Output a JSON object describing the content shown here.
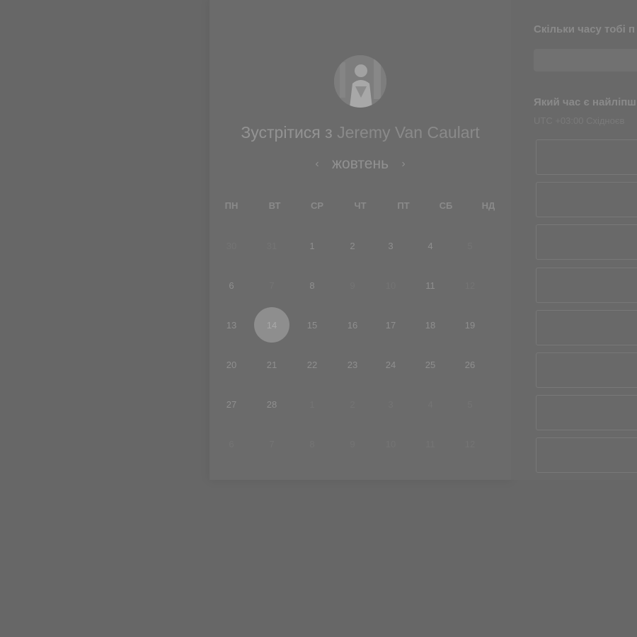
{
  "calendar": {
    "title_prefix": "Зустрітися з",
    "person_name": "Jeremy Van Caulart",
    "month": "жовтень",
    "prev_arrow": "‹",
    "next_arrow": "›",
    "weekdays": [
      "ПН",
      "ВТ",
      "СР",
      "ЧТ",
      "ПТ",
      "СБ",
      "НД"
    ],
    "weeks": [
      [
        {
          "d": "30",
          "m": true
        },
        {
          "d": "31",
          "m": true
        },
        {
          "d": "1",
          "m": false
        },
        {
          "d": "2",
          "m": false
        },
        {
          "d": "3",
          "m": false
        },
        {
          "d": "4",
          "m": false
        },
        {
          "d": "5",
          "m": true
        }
      ],
      [
        {
          "d": "6",
          "m": false
        },
        {
          "d": "7",
          "m": true
        },
        {
          "d": "8",
          "m": false
        },
        {
          "d": "9",
          "m": true
        },
        {
          "d": "10",
          "m": true
        },
        {
          "d": "11",
          "m": false
        },
        {
          "d": "12",
          "m": true
        }
      ],
      [
        {
          "d": "13",
          "m": false
        },
        {
          "d": "14",
          "m": false,
          "selected": true
        },
        {
          "d": "15",
          "m": false
        },
        {
          "d": "16",
          "m": false
        },
        {
          "d": "17",
          "m": false
        },
        {
          "d": "18",
          "m": false
        },
        {
          "d": "19",
          "m": false
        }
      ],
      [
        {
          "d": "20",
          "m": false
        },
        {
          "d": "21",
          "m": false
        },
        {
          "d": "22",
          "m": false
        },
        {
          "d": "23",
          "m": false
        },
        {
          "d": "24",
          "m": false
        },
        {
          "d": "25",
          "m": false
        },
        {
          "d": "26",
          "m": false
        }
      ],
      [
        {
          "d": "27",
          "m": false
        },
        {
          "d": "28",
          "m": false
        },
        {
          "d": "1",
          "m": true
        },
        {
          "d": "2",
          "m": true
        },
        {
          "d": "3",
          "m": true
        },
        {
          "d": "4",
          "m": true
        },
        {
          "d": "5",
          "m": true
        }
      ],
      [
        {
          "d": "6",
          "m": true
        },
        {
          "d": "7",
          "m": true
        },
        {
          "d": "8",
          "m": true
        },
        {
          "d": "9",
          "m": true
        },
        {
          "d": "10",
          "m": true
        },
        {
          "d": "11",
          "m": true
        },
        {
          "d": "12",
          "m": true
        }
      ]
    ]
  },
  "panel": {
    "duration_question": "Скільки часу тобі п",
    "time_question": "Який час є найліпш",
    "timezone": "UTC +03:00 Східноєв",
    "slot_count": 8
  }
}
